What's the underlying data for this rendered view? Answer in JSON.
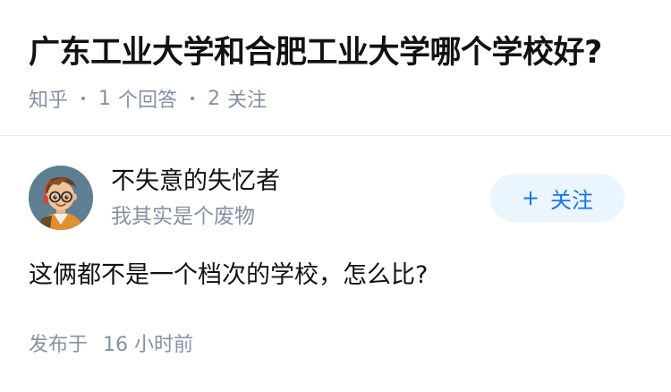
{
  "question": {
    "title": "广东工业大学和合肥工业大学哪个学校好?",
    "source": "知乎",
    "answer_count": "1",
    "answer_label": "个回答",
    "follow_count": "2",
    "follow_label": "关注"
  },
  "answer": {
    "author_name": "不失意的失忆者",
    "author_bio": "我其实是个废物",
    "follow_button": {
      "icon": "+",
      "label": "关注"
    },
    "content": "这俩都不是一个档次的学校，怎么比?",
    "publish_prefix": "发布于",
    "publish_time": "16 小时前"
  },
  "colors": {
    "accent": "#1772f6",
    "accent_bg": "#ebf5fd",
    "meta_gray": "#8590a6",
    "text": "#121212"
  },
  "icons": {
    "avatar": "cartoon-boy-avatar",
    "follow": "plus-icon"
  }
}
